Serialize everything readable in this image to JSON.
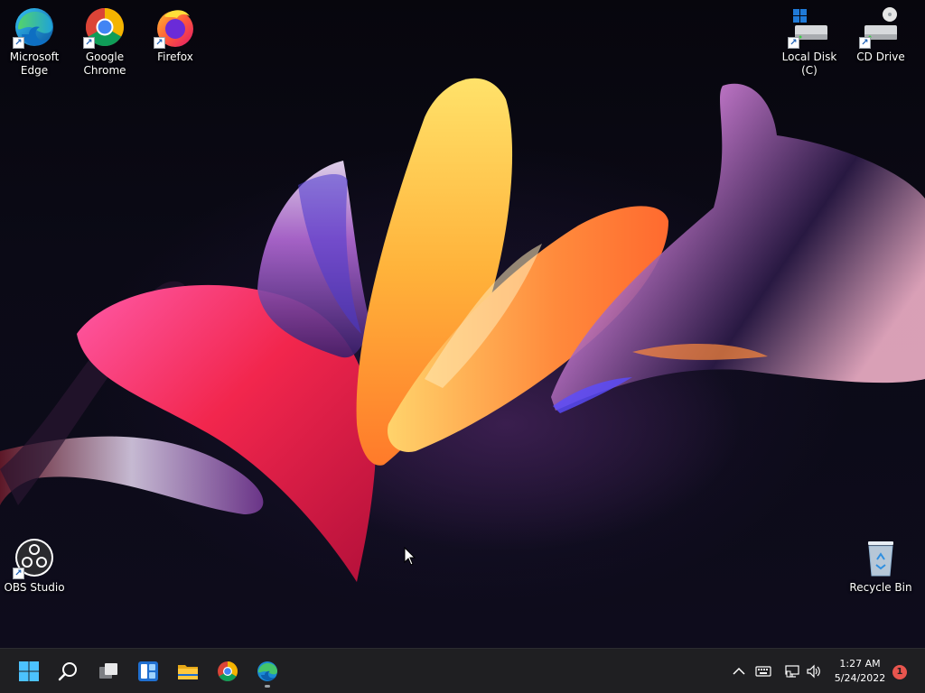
{
  "desktop": {
    "icons": [
      {
        "label": "Microsoft\nEdge",
        "icon": "edge-icon"
      },
      {
        "label": "Google\nChrome",
        "icon": "chrome-icon"
      },
      {
        "label": "Firefox",
        "icon": "firefox-icon"
      },
      {
        "label": "Local Disk (C)",
        "icon": "local-disk-icon"
      },
      {
        "label": "CD Drive",
        "icon": "cd-drive-icon"
      },
      {
        "label": "OBS Studio",
        "icon": "obs-studio-icon"
      },
      {
        "label": "Recycle Bin",
        "icon": "recycle-bin-icon"
      }
    ]
  },
  "taskbar": {
    "pinned": [
      {
        "name": "start",
        "icon": "windows-start-icon"
      },
      {
        "name": "search",
        "icon": "search-icon"
      },
      {
        "name": "task-view",
        "icon": "task-view-icon"
      },
      {
        "name": "widgets",
        "icon": "widgets-icon"
      },
      {
        "name": "file-explorer",
        "icon": "folder-icon"
      },
      {
        "name": "chrome",
        "icon": "chrome-icon"
      },
      {
        "name": "edge",
        "icon": "edge-icon",
        "running": true
      }
    ],
    "tray": {
      "icons": [
        "chevron-up-icon",
        "keyboard-icon",
        "network-icon",
        "volume-icon"
      ],
      "time": "1:27 AM",
      "date": "5/24/2022",
      "notification_count": "1"
    }
  },
  "colors": {
    "taskbar_bg": "#1f1f22",
    "accent_blue": "#0078d4",
    "badge_red": "#e8554e"
  }
}
